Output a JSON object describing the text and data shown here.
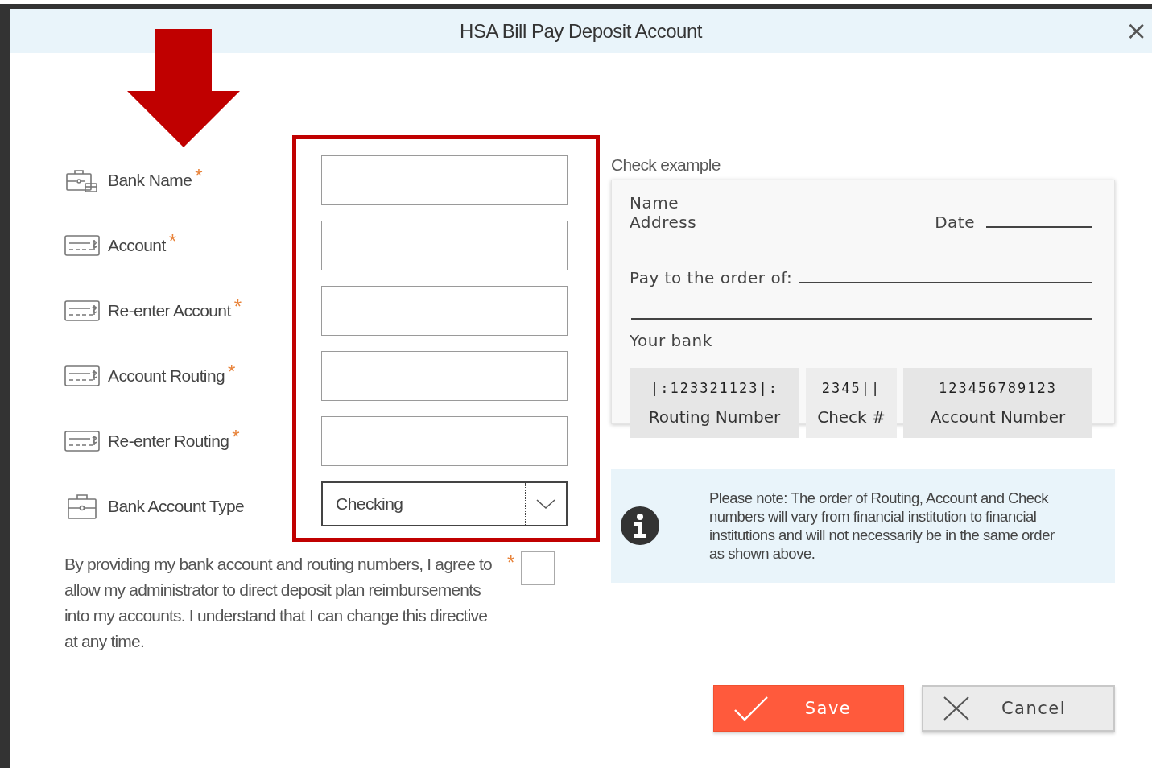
{
  "dialog": {
    "title": "HSA Bill Pay Deposit Account",
    "close": "×"
  },
  "fields": [
    {
      "label": "Bank Name",
      "kind": "bank",
      "mark": "*"
    },
    {
      "label": "Account",
      "kind": "number",
      "mark": "*"
    },
    {
      "label": "Re-enter Account",
      "kind": "number",
      "mark": "*"
    },
    {
      "label": "Account Routing",
      "kind": "number",
      "mark": "*"
    },
    {
      "label": "Re-enter Routing",
      "kind": "number",
      "mark": "*"
    },
    {
      "label": "Bank Account Type",
      "kind": "select",
      "value": "Checking"
    }
  ],
  "consent": {
    "text": "By providing my bank account and routing numbers, I agree to allow my administrator to direct deposit plan reimbursements into my accounts. I understand that I can change this directive at any time.",
    "mark": "*",
    "checked": false
  },
  "check_example": {
    "title": "Check example",
    "name": "Name",
    "address": "Address",
    "date_label": "Date",
    "pay_label": "Pay to the order of:",
    "bank": "Your bank",
    "micr": [
      {
        "digits": "|:123321123|:",
        "label": "Routing Number"
      },
      {
        "digits": "2345||",
        "label": "Check #"
      },
      {
        "digits": "123456789123",
        "label": "Account Number"
      }
    ]
  },
  "note": {
    "text": "Please note: The order of Routing, Account and Check numbers will vary from financial institution to financial institutions and will not necessarily be in the same order as shown above."
  },
  "buttons": [
    {
      "label": "Save",
      "kind": "primary"
    },
    {
      "label": "Cancel",
      "kind": "secondary"
    }
  ],
  "annotation": {
    "arrow": true,
    "frame": true
  }
}
